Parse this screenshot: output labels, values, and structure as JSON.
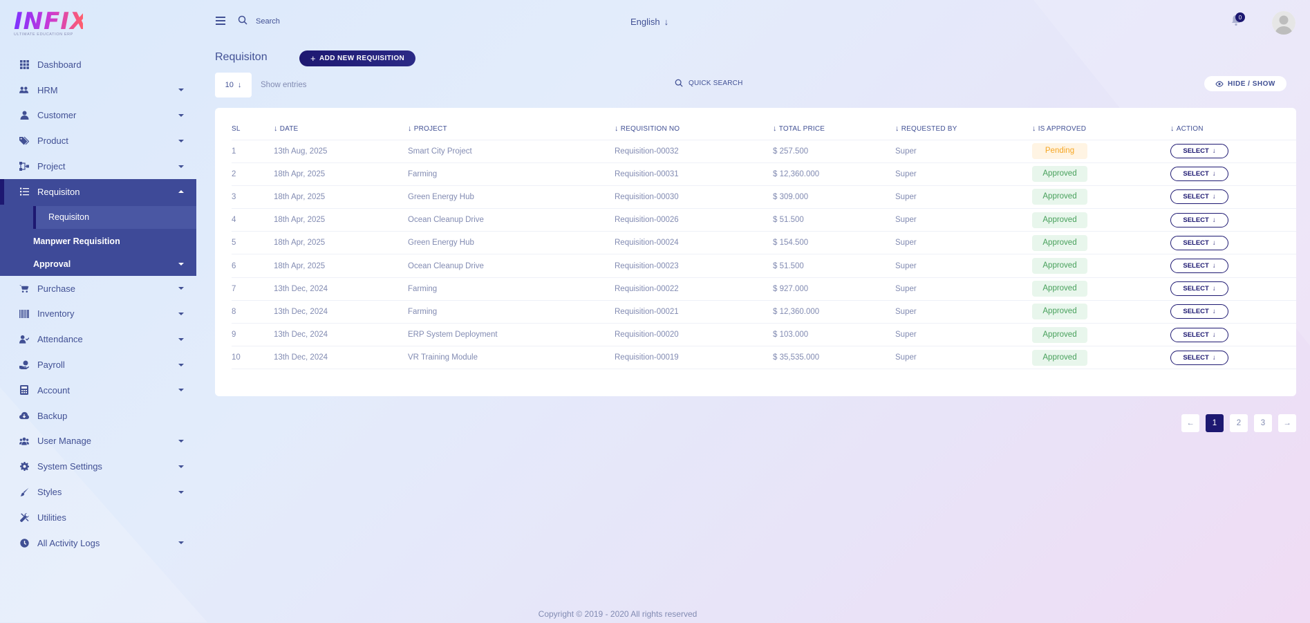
{
  "app": {
    "logo_text": "INFIX",
    "logo_subtitle": "ULTIMATE EDUCATION ERP"
  },
  "topbar": {
    "search_placeholder": "Search",
    "language": "English",
    "notification_count": "0"
  },
  "sidebar": {
    "items": [
      {
        "label": "Dashboard",
        "icon": "grid-icon",
        "has_caret": false
      },
      {
        "label": "HRM",
        "icon": "people-gear-icon",
        "has_caret": true
      },
      {
        "label": "Customer",
        "icon": "user-icon",
        "has_caret": true
      },
      {
        "label": "Product",
        "icon": "tags-icon",
        "has_caret": true
      },
      {
        "label": "Project",
        "icon": "diagram-icon",
        "has_caret": true
      }
    ],
    "active_group": {
      "label": "Requisiton",
      "icon": "list-check-icon",
      "children": [
        {
          "label": "Requisiton",
          "current": true
        },
        {
          "label": "Manpwer Requisition",
          "current": false
        },
        {
          "label": "Approval",
          "current": false,
          "has_caret": true
        }
      ]
    },
    "items_after": [
      {
        "label": "Purchase",
        "icon": "cart-icon",
        "has_caret": true
      },
      {
        "label": "Inventory",
        "icon": "barcode-icon",
        "has_caret": true
      },
      {
        "label": "Attendance",
        "icon": "user-check-icon",
        "has_caret": true
      },
      {
        "label": "Payroll",
        "icon": "money-icon",
        "has_caret": true
      },
      {
        "label": "Account",
        "icon": "calculator-icon",
        "has_caret": true
      },
      {
        "label": "Backup",
        "icon": "cloud-download-icon",
        "has_caret": false
      },
      {
        "label": "User Manage",
        "icon": "users-icon",
        "has_caret": true
      },
      {
        "label": "System Settings",
        "icon": "gear-icon",
        "has_caret": true
      },
      {
        "label": "Styles",
        "icon": "brush-icon",
        "has_caret": true
      },
      {
        "label": "Utilities",
        "icon": "tools-icon",
        "has_caret": false
      },
      {
        "label": "All Activity Logs",
        "icon": "clock-icon",
        "has_caret": true
      }
    ]
  },
  "main": {
    "title": "Requisiton",
    "add_button": "ADD NEW REQUISITION",
    "entries_value": "10",
    "entries_label": "Show entries",
    "quick_search": "QUICK SEARCH",
    "hide_show": "HIDE / SHOW",
    "columns": [
      "SL",
      "DATE",
      "PROJECT",
      "REQUISITION NO",
      "TOTAL PRICE",
      "REQUESTED BY",
      "IS APPROVED",
      "ACTION"
    ],
    "rows": [
      {
        "sl": "1",
        "date": "13th Aug, 2025",
        "project": "Smart City Project",
        "req_no": "Requisition-00032",
        "price": "$ 257.500",
        "by": "Super",
        "status": "Pending",
        "action": "SELECT"
      },
      {
        "sl": "2",
        "date": "18th Apr, 2025",
        "project": "Farming",
        "req_no": "Requisition-00031",
        "price": "$ 12,360.000",
        "by": "Super",
        "status": "Approved",
        "action": "SELECT"
      },
      {
        "sl": "3",
        "date": "18th Apr, 2025",
        "project": "Green Energy Hub",
        "req_no": "Requisition-00030",
        "price": "$ 309.000",
        "by": "Super",
        "status": "Approved",
        "action": "SELECT"
      },
      {
        "sl": "4",
        "date": "18th Apr, 2025",
        "project": "Ocean Cleanup Drive",
        "req_no": "Requisition-00026",
        "price": "$ 51.500",
        "by": "Super",
        "status": "Approved",
        "action": "SELECT"
      },
      {
        "sl": "5",
        "date": "18th Apr, 2025",
        "project": "Green Energy Hub",
        "req_no": "Requisition-00024",
        "price": "$ 154.500",
        "by": "Super",
        "status": "Approved",
        "action": "SELECT"
      },
      {
        "sl": "6",
        "date": "18th Apr, 2025",
        "project": "Ocean Cleanup Drive",
        "req_no": "Requisition-00023",
        "price": "$ 51.500",
        "by": "Super",
        "status": "Approved",
        "action": "SELECT"
      },
      {
        "sl": "7",
        "date": "13th Dec, 2024",
        "project": "Farming",
        "req_no": "Requisition-00022",
        "price": "$ 927.000",
        "by": "Super",
        "status": "Approved",
        "action": "SELECT"
      },
      {
        "sl": "8",
        "date": "13th Dec, 2024",
        "project": "Farming",
        "req_no": "Requisition-00021",
        "price": "$ 12,360.000",
        "by": "Super",
        "status": "Approved",
        "action": "SELECT"
      },
      {
        "sl": "9",
        "date": "13th Dec, 2024",
        "project": "ERP System Deployment",
        "req_no": "Requisition-00020",
        "price": "$ 103.000",
        "by": "Super",
        "status": "Approved",
        "action": "SELECT"
      },
      {
        "sl": "10",
        "date": "13th Dec, 2024",
        "project": "VR Training Module",
        "req_no": "Requisition-00019",
        "price": "$ 35,535.000",
        "by": "Super",
        "status": "Approved",
        "action": "SELECT"
      }
    ],
    "pagination": {
      "pages": [
        "1",
        "2",
        "3"
      ],
      "current": "1"
    }
  },
  "footer": {
    "text": "Copyright © 2019 - 2020 All rights reserved"
  },
  "colors": {
    "primary": "#1d1871",
    "sidebar_active": "#3e4a98",
    "text": "#415094",
    "muted": "#828bb2",
    "pending": "#f5a623",
    "approved": "#47a05b"
  }
}
